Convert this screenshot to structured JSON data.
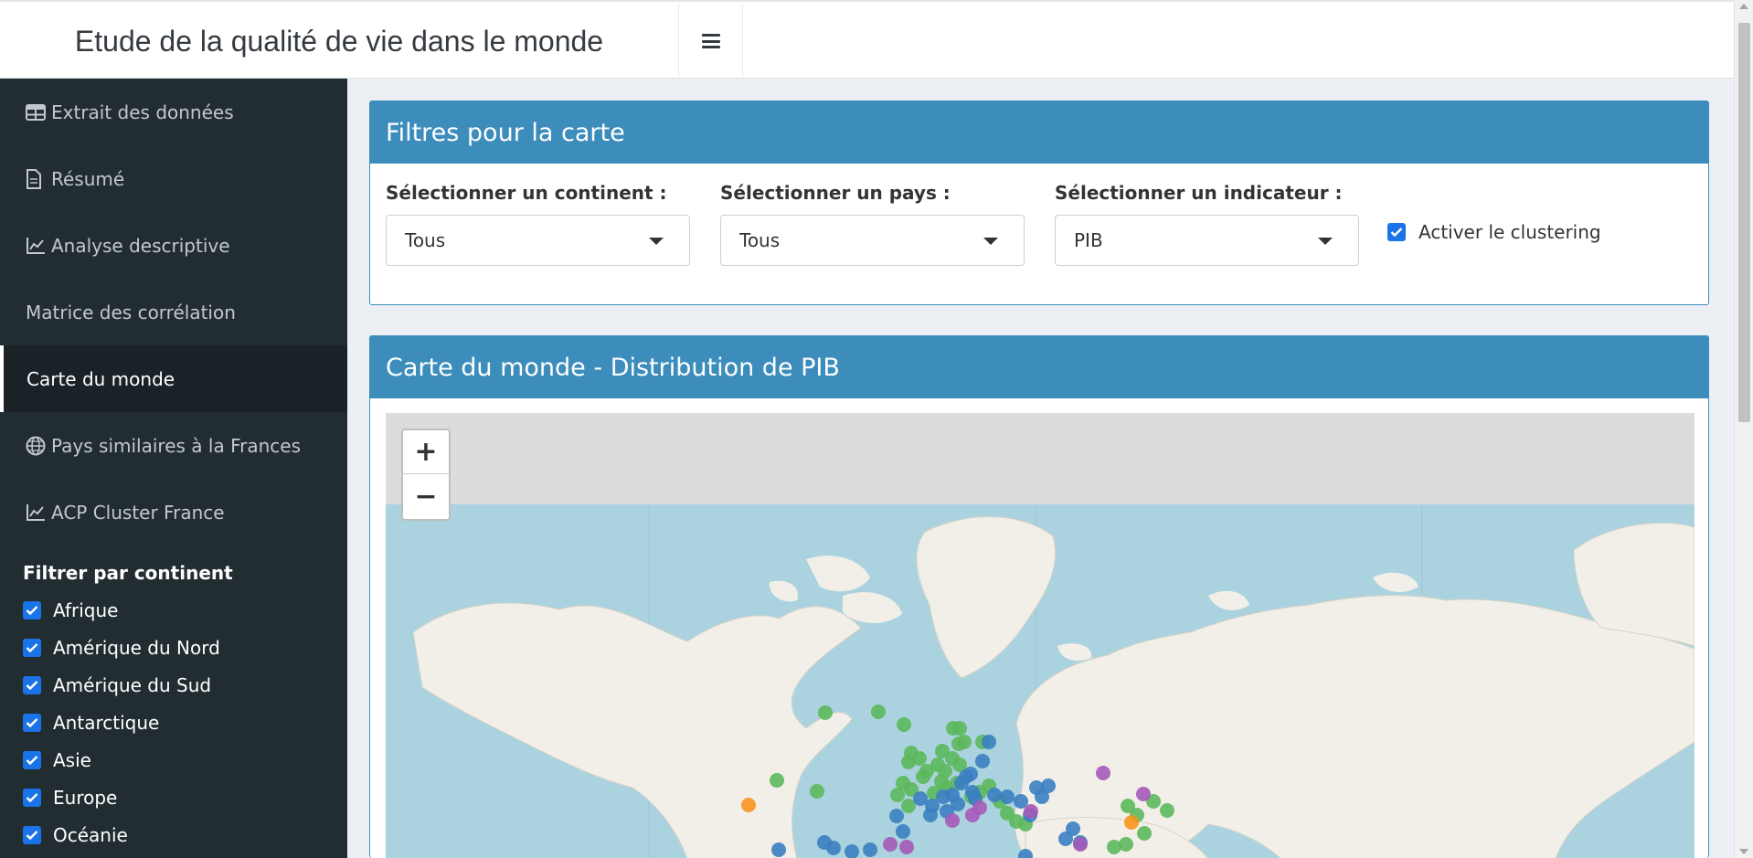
{
  "header": {
    "title": "Etude de la qualité de vie dans le monde"
  },
  "sidebar": {
    "items": [
      {
        "label": "Extrait des données",
        "icon": "table-icon"
      },
      {
        "label": "Résumé",
        "icon": "file-icon"
      },
      {
        "label": "Analyse descriptive",
        "icon": "line-chart-icon"
      },
      {
        "label": "Matrice des corrélation",
        "icon": ""
      },
      {
        "label": "Carte du monde",
        "icon": "",
        "active": true
      },
      {
        "label": "Pays similaires à la Frances",
        "icon": "globe-icon"
      },
      {
        "label": "ACP Cluster France",
        "icon": "line-chart-icon"
      }
    ],
    "filter": {
      "title": "Filtrer par continent",
      "options": [
        "Afrique",
        "Amérique du Nord",
        "Amérique du Sud",
        "Antarctique",
        "Asie",
        "Europe",
        "Océanie"
      ]
    }
  },
  "filters_box": {
    "title": "Filtres pour la carte",
    "continent": {
      "label": "Sélectionner un continent :",
      "value": "Tous"
    },
    "country": {
      "label": "Sélectionner un pays :",
      "value": "Tous"
    },
    "indicator": {
      "label": "Sélectionner un indicateur :",
      "value": "PIB"
    },
    "clustering": {
      "label": "Activer le clustering",
      "checked": true
    }
  },
  "map_box": {
    "title": "Carte du monde - Distribution de PIB",
    "zoom_in": "+",
    "zoom_out": "−"
  },
  "colors": {
    "header_blue": "#3c8dbc",
    "sidebar_bg": "#222d32",
    "water": "#aad3df",
    "land": "#f2efe9",
    "marker_green": "#5cb85c",
    "marker_blue": "#3a7fc1",
    "marker_purple": "#a45ab8",
    "marker_orange": "#f7931e"
  }
}
